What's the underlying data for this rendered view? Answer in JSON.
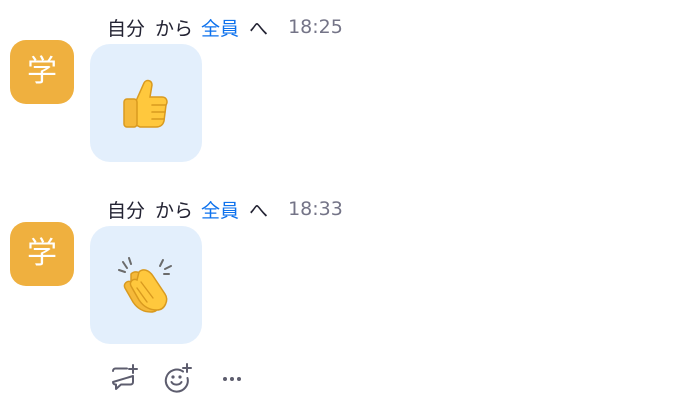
{
  "messages": [
    {
      "avatar_text": "学",
      "avatar_color": "#EFB03F",
      "sender": "自分",
      "from_word": "から",
      "recipient": "全員",
      "to_word": "へ",
      "time": "18:25",
      "content_icon": "thumbs-up-emoji"
    },
    {
      "avatar_text": "学",
      "avatar_color": "#EFB03F",
      "sender": "自分",
      "from_word": "から",
      "recipient": "全員",
      "to_word": "へ",
      "time": "18:33",
      "content_icon": "clapping-hands-emoji"
    }
  ],
  "actions": [
    "reply-icon",
    "add-reaction-icon",
    "more-options-icon"
  ],
  "colors": {
    "accent": "#0E72ED",
    "bubble": "#E3EFFC",
    "time": "#747487",
    "emoji_yellow": "#FFC83D"
  }
}
